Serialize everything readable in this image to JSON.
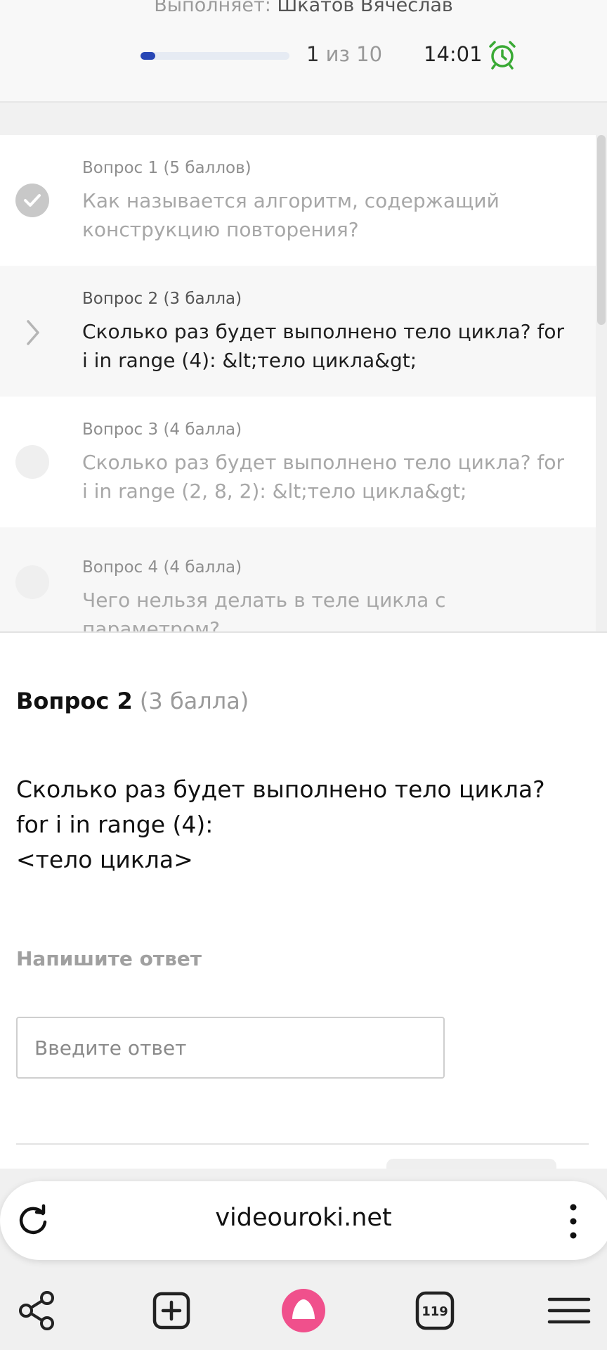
{
  "header": {
    "performer_label": "Выполняет:",
    "performer_name": "Шкатов Вячеслав",
    "progress": {
      "current": 1,
      "total": 10,
      "fraction": 0.1
    },
    "counter_current": "1",
    "counter_of": "из 10",
    "timer": "14:01",
    "timer_icon": "alarm-clock-icon",
    "accent_color": "#2746b5",
    "timer_icon_color": "#3aaa35"
  },
  "questions": [
    {
      "head": "Вопрос 1 (5 баллов)",
      "text": "Как называется алгоритм, содержащий конструкцию повторения?",
      "status": "answered"
    },
    {
      "head": "Вопрос 2 (3 балла)",
      "text": "Сколько раз будет выполнено тело цикла? for i in range (4): &lt;тело цикла&gt;",
      "status": "current"
    },
    {
      "head": "Вопрос 3 (4 балла)",
      "text": "Сколько раз будет выполнено тело цикла? for i in range (2, 8, 2): &lt;тело цикла&gt;",
      "status": "pending"
    },
    {
      "head": "Вопрос 4 (4 балла)",
      "text": "Чего нельзя делать в теле цикла с параметром?",
      "status": "pending"
    }
  ],
  "detail": {
    "title": "Вопрос 2",
    "points": "(3 балла)",
    "line1": "Сколько раз будет выполнено тело цикла?",
    "line2": "for i in range (4):",
    "line3": "<тело цикла>",
    "answer_label": "Напишите ответ",
    "answer_placeholder": "Введите ответ",
    "answer_value": ""
  },
  "browser": {
    "url": "videouroki.net",
    "tabs_count": "119",
    "alice_color": "#f0508c"
  }
}
